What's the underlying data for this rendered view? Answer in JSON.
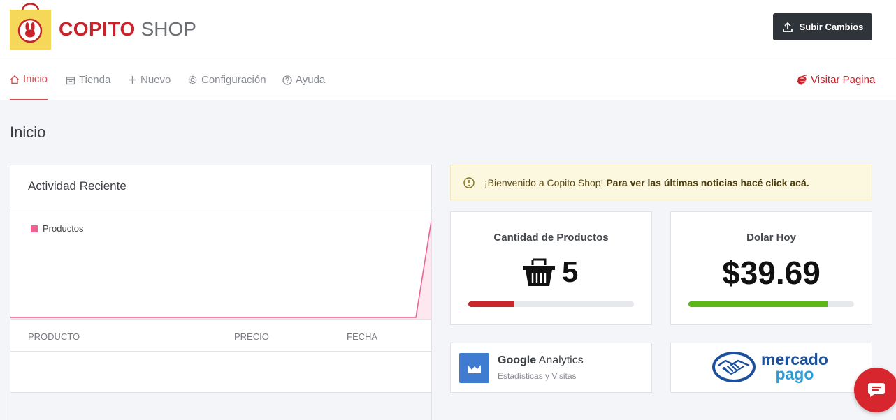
{
  "header": {
    "brand_bold": "COPITO",
    "brand_light": " SHOP",
    "upload_label": "Subir Cambios"
  },
  "nav": {
    "items": [
      {
        "label": "Inicio",
        "icon": "home-icon",
        "active": true
      },
      {
        "label": "Tienda",
        "icon": "store-icon"
      },
      {
        "label": "Nuevo",
        "icon": "plus-icon"
      },
      {
        "label": "Configuración",
        "icon": "gear-icon"
      },
      {
        "label": "Ayuda",
        "icon": "help-icon"
      }
    ],
    "visit_label": "Visitar Pagina"
  },
  "page": {
    "title": "Inicio"
  },
  "activity": {
    "title": "Actividad Reciente",
    "legend": "Productos",
    "columns": [
      "PRODUCTO",
      "PRECIO",
      "FECHA"
    ],
    "rows": []
  },
  "alert": {
    "text": "¡Bienvenido a Copito Shop!",
    "strong": "Para ver las últimas noticias hacé click acá."
  },
  "stats": {
    "products": {
      "title": "Cantidad de Productos",
      "value": "5",
      "progress": 0.28,
      "color": "#c9272d"
    },
    "dollar": {
      "title": "Dolar Hoy",
      "value": "$39.69",
      "progress": 0.84,
      "color": "#5cb815"
    }
  },
  "integrations": {
    "google": {
      "name_bold": "Google",
      "name_light": " Analytics",
      "subtitle": "Estadísticas y Visitas"
    },
    "mercadopago": {
      "line1": "mercado",
      "line2": "pago"
    }
  },
  "colors": {
    "brand_red": "#c8232b",
    "chart_pink": "#f06292",
    "header_button": "#2f333a"
  }
}
